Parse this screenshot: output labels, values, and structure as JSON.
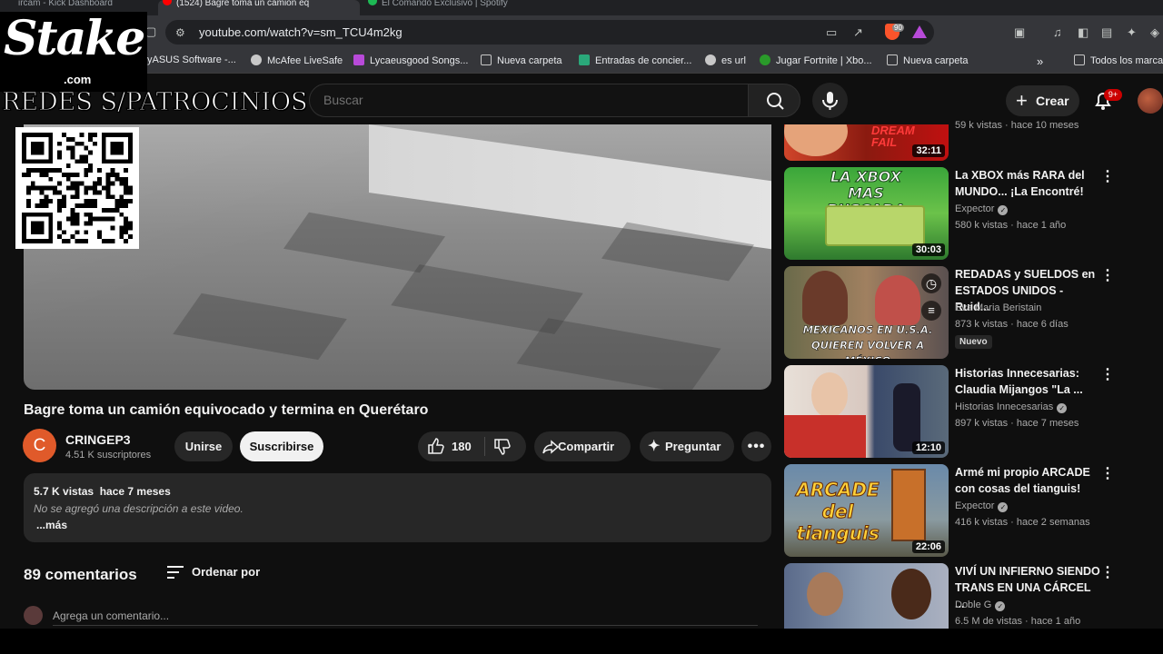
{
  "browser": {
    "tabs": [
      {
        "label": "ircam - Kick Dashboard",
        "active": false
      },
      {
        "label": "(1524) Bagre toma un camión eq",
        "active": true
      },
      {
        "label": "El Comando Exclusivo | Spotify",
        "active": false
      }
    ],
    "url": "youtube.com/watch?v=sm_TCU4m2kg",
    "brave_count": "90",
    "bookmarks": [
      {
        "label": "yASUS Software -...",
        "icon_color": "#4a90d9"
      },
      {
        "label": "McAfee LiveSafe",
        "icon_color": "#c8c8c8"
      },
      {
        "label": "Lycaeusgood Songs...",
        "icon_color": "#b84ad9"
      },
      {
        "label": "Nueva carpeta",
        "icon_color": "folder"
      },
      {
        "label": "Entradas de concier...",
        "icon_color": "#2aa87a"
      },
      {
        "label": "es url",
        "icon_color": "#c8c8c8"
      },
      {
        "label": "Jugar Fortnite | Xbo...",
        "icon_color": "#2a9a2a"
      },
      {
        "label": "Nueva carpeta",
        "icon_color": "folder"
      }
    ],
    "all_bookmarks": "Todos los marca"
  },
  "overlay": {
    "brand": "Stake",
    "domain": ".com",
    "caption": "REDES S/PATROCINIOS"
  },
  "header": {
    "search_placeholder": "Buscar",
    "create_label": "Crear",
    "notif_count": "9+"
  },
  "video": {
    "title": "Bagre toma un camión equivocado y termina en Querétaro",
    "channel": "CRINGEP3",
    "channel_initial": "C",
    "subscribers": "4.51 K suscriptores",
    "join_label": "Unirse",
    "subscribe_label": "Suscribirse",
    "likes": "180",
    "share_label": "Compartir",
    "ask_label": "Preguntar",
    "views_date": "5.7 K vistas  hace 7 meses",
    "description": "No se agregó una descripción a este video.",
    "more_label": "...más"
  },
  "comments": {
    "count_label": "89 comentarios",
    "sort_label": "Ordenar por",
    "placeholder": "Agrega un comentario..."
  },
  "sidebar": {
    "top_partial": {
      "meta": "59 k vistas · hace 10 meses",
      "duration": "32:11"
    },
    "items": [
      {
        "title": "La XBOX más RARA del MUNDO... ¡La Encontré!",
        "channel": "Expector",
        "verified": true,
        "meta": "580 k vistas · hace 1 año",
        "duration": "30:03",
        "thumb_text": "LA XBOX MAS BUSCADA"
      },
      {
        "title": "REDADAS y SUELDOS en ESTADOS UNIDOS - Ruid...",
        "channel": "Eva Maria Beristain",
        "verified": false,
        "meta": "873 k vistas · hace 6 días",
        "badge": "Nuevo",
        "duration": "",
        "thumb_text": "MEXICANOS EN U.S.A. QUIEREN VOLVER A MÉXICO"
      },
      {
        "title": "Historias Innecesarias: Claudia Mijangos \"La ...",
        "channel": "Historias Innecesarias",
        "verified": true,
        "meta": "897 k vistas · hace 7 meses",
        "duration": "12:10"
      },
      {
        "title": "Armé mi propio ARCADE con cosas del tianguis!",
        "channel": "Expector",
        "verified": true,
        "meta": "416 k vistas · hace 2 semanas",
        "duration": "22:06",
        "thumb_text": "ARCADE del tianguis"
      },
      {
        "title": "VIVÍ UN INFIERNO SIENDO TRANS EN UNA CÁRCEL ...",
        "channel": "Doble G",
        "verified": true,
        "meta": "6.5 M de vistas · hace 1 año",
        "duration": ""
      }
    ]
  }
}
